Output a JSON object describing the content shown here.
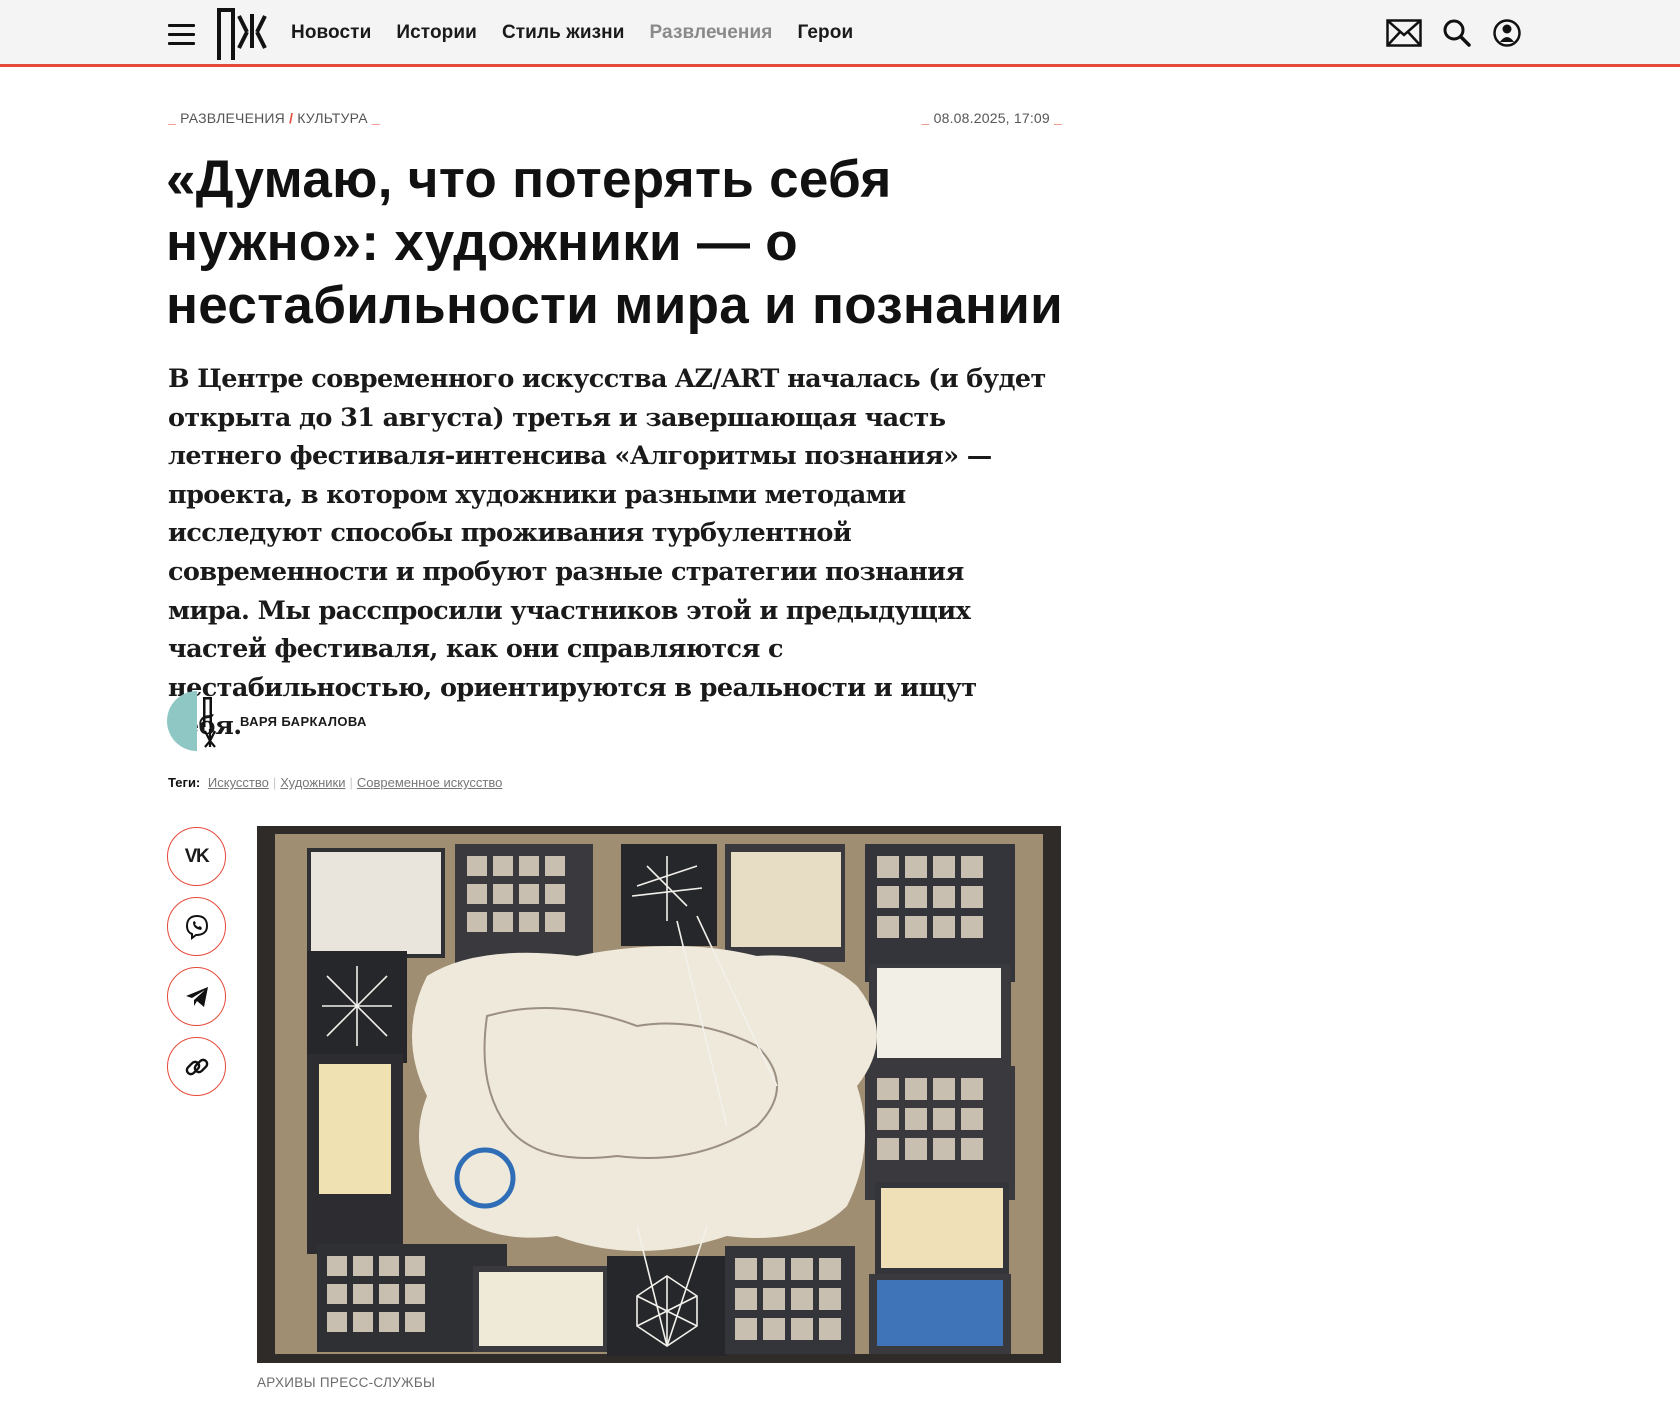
{
  "header": {
    "logo_text": "ПЖ",
    "nav": [
      {
        "label": "Новости",
        "dim": false
      },
      {
        "label": "Истории",
        "dim": false
      },
      {
        "label": "Стиль жизни",
        "dim": false
      },
      {
        "label": "Развлечения",
        "dim": true
      },
      {
        "label": "Герои",
        "dim": false
      }
    ],
    "icons": [
      "mail-icon",
      "search-icon",
      "user-icon"
    ]
  },
  "article": {
    "breadcrumb": [
      "РАЗВЛЕЧЕНИЯ",
      "КУЛЬТУРА"
    ],
    "breadcrumb_separator": "/",
    "date": "08.08.2025, 17:09",
    "title": "«Думаю, что потерять себя нужно»: художники — о нестабильности мира и познании",
    "lead": "В Центре современного искусства AZ/ART началась (и будет открыта до 31 августа) третья и завершающая часть летнего фестиваля-интенсива «Алгоритмы познания» — проекта, в котором художники разными методами исследуют способы проживания турбулентной современности и пробуют разные стратегии познания мира. Мы расспросили участников этой и предыдущих частей фестиваля, как они справляются с нестабильностью, ориентируются в реальности и ищут себя.",
    "author": "ВАРЯ БАРКАЛОВА",
    "tags_label": "Теги:",
    "tags": [
      "Искусство",
      "Художники",
      "Современное искусство"
    ],
    "share": [
      {
        "name": "vk",
        "label": "VK"
      },
      {
        "name": "viber",
        "label": ""
      },
      {
        "name": "telegram",
        "label": ""
      },
      {
        "name": "copy-link",
        "label": ""
      }
    ],
    "photo_caption": "АРХИВЫ ПРЕСС-СЛУЖБЫ"
  },
  "colors": {
    "accent": "#e5493a",
    "header_bg": "#f4f4f5",
    "avatar_teal": "#8fc7c4"
  }
}
